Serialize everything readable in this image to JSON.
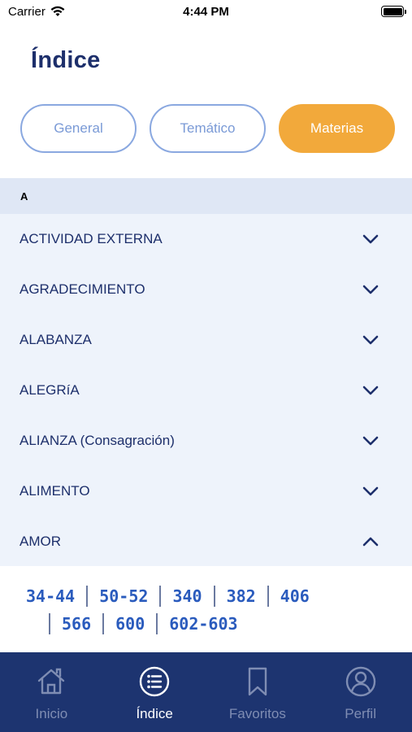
{
  "status_bar": {
    "carrier": "Carrier",
    "time": "4:44 PM"
  },
  "page": {
    "title": "Índice"
  },
  "tabs": [
    {
      "label": "General"
    },
    {
      "label": "Temático"
    },
    {
      "label": "Materias"
    }
  ],
  "section": {
    "letter": "A"
  },
  "items": [
    {
      "label": "ACTIVIDAD EXTERNA"
    },
    {
      "label": "AGRADECIMIENTO"
    },
    {
      "label": "ALABANZA"
    },
    {
      "label": "ALEGRíA"
    },
    {
      "label": "ALIANZA (Consagración)"
    },
    {
      "label": "ALIMENTO"
    },
    {
      "label": "AMOR"
    }
  ],
  "expanded_refs": {
    "row1": [
      "34-44",
      "50-52",
      "340",
      "382",
      "406"
    ],
    "row2": [
      "566",
      "600",
      "602-603"
    ]
  },
  "nav": [
    {
      "label": "Inicio",
      "icon": "home-icon"
    },
    {
      "label": "Índice",
      "icon": "list-icon"
    },
    {
      "label": "Favoritos",
      "icon": "bookmark-icon"
    },
    {
      "label": "Perfil",
      "icon": "profile-icon"
    }
  ],
  "colors": {
    "primary": "#1d2f6b",
    "accent": "#f2a93b",
    "link": "#2a5bbd",
    "nav_bg": "#1d3470",
    "list_bg": "#eef3fb"
  }
}
